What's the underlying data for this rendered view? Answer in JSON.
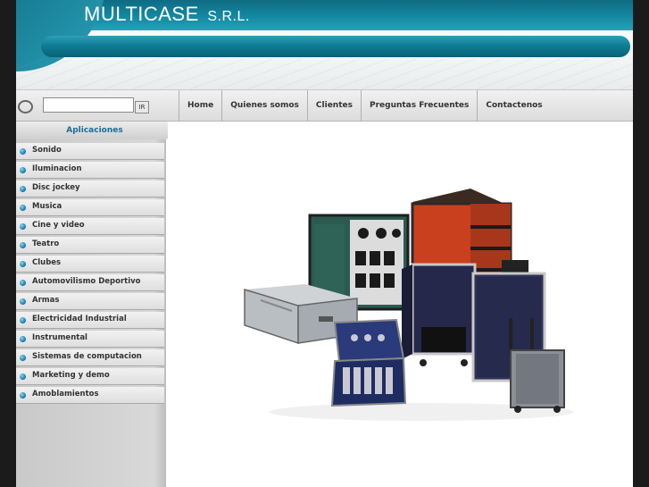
{
  "header": {
    "logo_main": "MULTICASE",
    "logo_sub": "S.R.L."
  },
  "search": {
    "placeholder": "",
    "value": "",
    "go_label": "IR"
  },
  "nav": {
    "items": [
      "Home",
      "Quienes somos",
      "Clientes",
      "Preguntas Frecuentes",
      "Contactenos"
    ]
  },
  "sidebar": {
    "title": "Aplicaciones",
    "items": [
      "Sonido",
      "Iluminacion",
      "Disc jockey",
      "Musica",
      "Cine y video",
      "Teatro",
      "Clubes",
      "Automovilismo Deportivo",
      "Armas",
      "Electricidad Industrial",
      "Instrumental",
      "Sistemas de computacion",
      "Marketing y demo",
      "Amoblamientos"
    ]
  },
  "colors": {
    "brand_teal": "#1489a2",
    "menu_title": "#1a6d9a",
    "case_orange": "#c9401e",
    "case_green": "#2c5a50",
    "case_navy": "#25284a"
  },
  "icons": {
    "search": "magnifier-icon",
    "menu_bullet": "blue-dot-icon"
  }
}
